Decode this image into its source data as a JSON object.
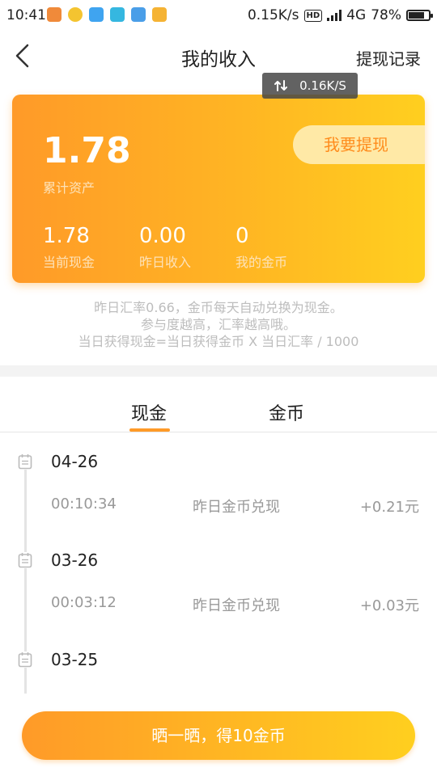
{
  "status_bar": {
    "time": "10:41",
    "net_speed": "0.15K/s",
    "hd": "HD",
    "network": "4G",
    "battery": "78%",
    "battery_level": 0.78
  },
  "header": {
    "title": "我的收入",
    "right_link": "提现记录"
  },
  "toast": {
    "speed": "0.16K/S"
  },
  "card": {
    "total_value": "1.78",
    "total_label": "累计资产",
    "withdraw_button": "我要提现",
    "stats": [
      {
        "value": "1.78",
        "label": "当前现金"
      },
      {
        "value": "0.00",
        "label": "昨日收入"
      },
      {
        "value": "0",
        "label": "我的金币"
      }
    ]
  },
  "notes": {
    "line1": "昨日汇率0.66，金币每天自动兑换为现金。",
    "line2": "参与度越高，汇率越高哦。",
    "line3": "当日获得现金=当日获得金币 X 当日汇率 / 1000"
  },
  "tabs": [
    {
      "label": "现金",
      "active": true
    },
    {
      "label": "金币",
      "active": false
    }
  ],
  "records": [
    {
      "date": "04-26",
      "time": "00:10:34",
      "desc": "昨日金币兑现",
      "amount": "+0.21元"
    },
    {
      "date": "03-26",
      "time": "00:03:12",
      "desc": "昨日金币兑现",
      "amount": "+0.03元"
    },
    {
      "date": "03-25"
    }
  ],
  "share_button": "晒一晒，得10金币",
  "colors": {
    "accent": "#ff9a28",
    "accent_light": "#ffcf1f"
  }
}
